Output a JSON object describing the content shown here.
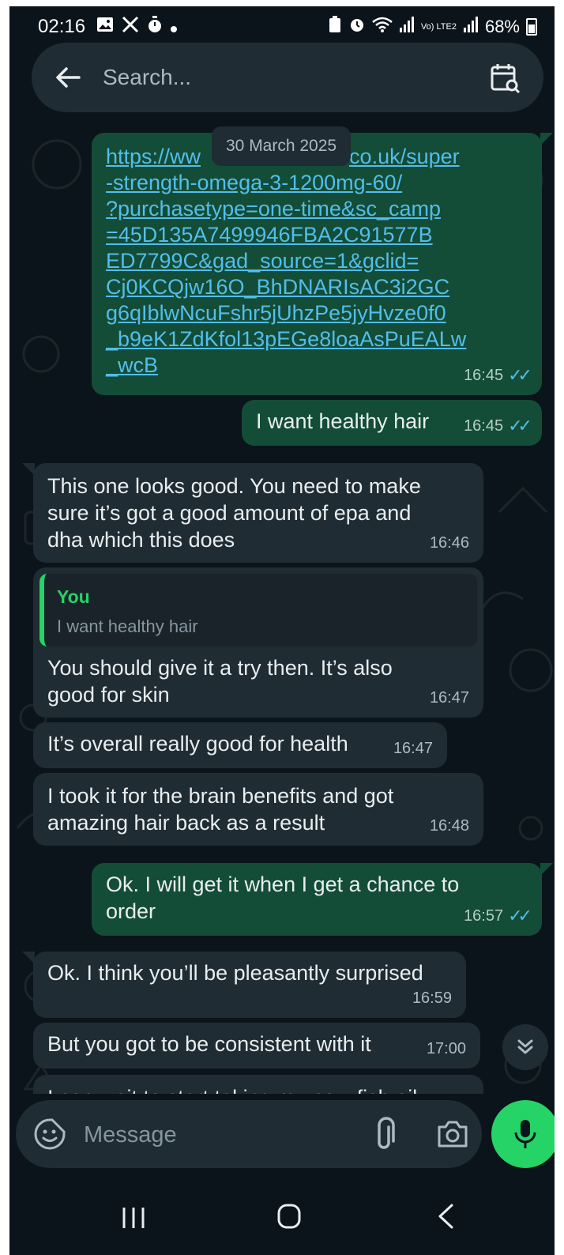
{
  "status_bar": {
    "time": "02:16",
    "battery": "68%",
    "signal_label": "Vo) LTE2"
  },
  "search": {
    "placeholder": "Search..."
  },
  "date_chip": "30 March 2025",
  "messages": [
    {
      "direction": "outgoing",
      "lines": [
        "https://ww",
        "-strength-omega-3-1200mg-60/",
        "?purchasetype=one-time&sc_camp",
        "=45D135A7499946FBA2C91577B",
        "ED7799C&gad_source=1&gclid=",
        "Cj0KCQjw16O_BhDNARIsAC3i2GC",
        "g6qIblwNcuFshr5jUhzPe5jyHvze0f0",
        "_b9eK1ZdKfol13pEGe8loaAsPuEALw",
        "_wcB"
      ],
      "first_line_tail": "co.uk/super",
      "time": "16:45",
      "is_link": true
    },
    {
      "direction": "outgoing",
      "text": "I want healthy hair",
      "time": "16:45"
    },
    {
      "direction": "incoming",
      "text": "This one looks good. You need to make\nsure it’s got a good amount of epa and\ndha which this does",
      "time": "16:46"
    },
    {
      "direction": "incoming",
      "quote": {
        "author": "You",
        "text": "I want healthy hair"
      },
      "text": "You should give it a try then. It’s also\ngood for skin",
      "time": "16:47"
    },
    {
      "direction": "incoming",
      "text": "It’s overall really good for health",
      "time": "16:47"
    },
    {
      "direction": "incoming",
      "text": "I took it for the brain benefits and got\namazing hair back as a result",
      "time": "16:48"
    },
    {
      "direction": "outgoing",
      "text": "Ok. I will get it when I get a chance to\norder",
      "time": "16:57"
    },
    {
      "direction": "incoming",
      "text": "Ok. I think you’ll be pleasantly surprised",
      "time": "16:59"
    },
    {
      "direction": "incoming",
      "text": "But you got to be consistent with it",
      "time": "17:00"
    },
    {
      "direction": "incoming",
      "text": "I can wait to start taking my new fish oil",
      "time": ""
    }
  ],
  "composer": {
    "placeholder": "Message"
  },
  "colors": {
    "background": "#0b141a",
    "outgoing_bubble": "#134d37",
    "incoming_bubble": "#1f2c33",
    "accent_green": "#25d366",
    "read_ticks": "#53bdeb"
  }
}
